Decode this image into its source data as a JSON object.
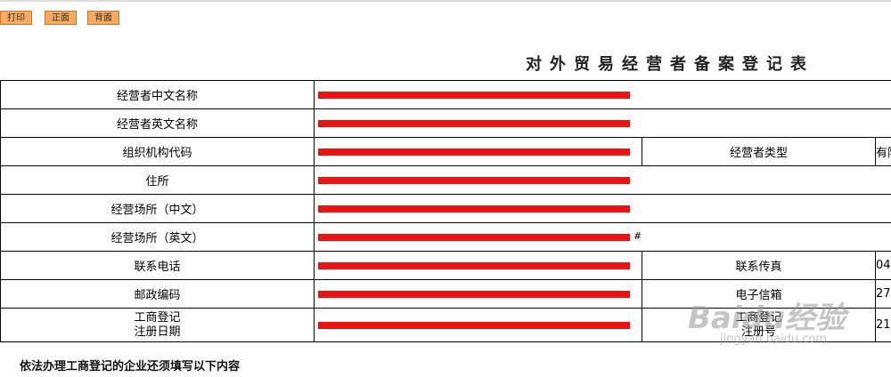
{
  "toolbar": {
    "print_label": "打印",
    "front_label": "正面",
    "back_label": "背面"
  },
  "page": {
    "title": "对外贸易经营者备案登记表",
    "footer_note": "依法办理工商登记的企业还须填写以下内容"
  },
  "form": {
    "rows": {
      "name_cn": {
        "label": "经营者中文名称"
      },
      "name_en": {
        "label": "经营者英文名称"
      },
      "org_code": {
        "label": "组织机构代码",
        "side_label": "经营者类型",
        "side_value": "有限"
      },
      "address": {
        "label": "住所"
      },
      "premises_cn": {
        "label": "经营场所（中文）"
      },
      "premises_en": {
        "label": "经营场所（英文）",
        "value_tail": "#"
      },
      "phone": {
        "label": "联系电话",
        "side_label": "联系传真",
        "side_value": "04"
      },
      "postcode": {
        "label": "邮政编码",
        "side_label": "电子信箱",
        "side_value": "27"
      },
      "registration": {
        "label_line1": "工商登记",
        "label_line2": "注册日期",
        "side_label_line1": "工商登记",
        "side_label_line2": "注册号",
        "side_value": "21"
      }
    }
  },
  "colors": {
    "redaction": "#ee1111",
    "button_bg": "#f5a961"
  },
  "watermark": {
    "logo": "Baidu经验",
    "url": "jingyan.baidu.com"
  }
}
